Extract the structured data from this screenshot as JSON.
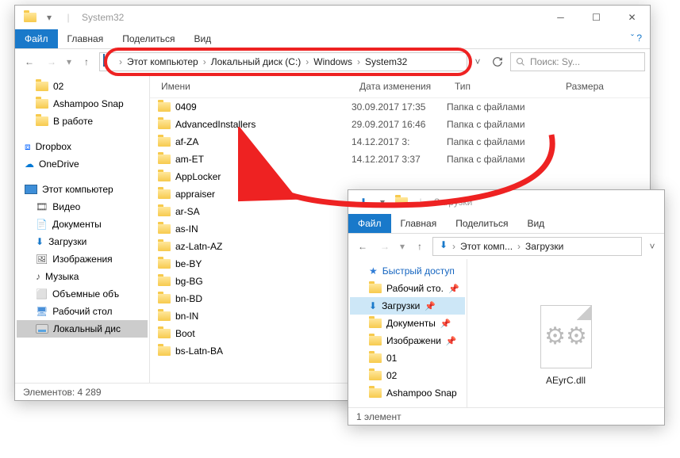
{
  "main": {
    "title": "System32",
    "ribbon": {
      "file": "Файл",
      "home": "Главная",
      "share": "Поделиться",
      "view": "Вид"
    },
    "breadcrumb": [
      "Этот компьютер",
      "Локальный диск (C:)",
      "Windows",
      "System32"
    ],
    "search_placeholder": "Поиск: Sy...",
    "columns": {
      "name": "Имени",
      "date": "Дата изменения",
      "type": "Тип",
      "size": "Размера"
    },
    "tree": [
      {
        "label": "02"
      },
      {
        "label": "Ashampoo Snap"
      },
      {
        "label": "В работе"
      },
      {
        "label": "Dropbox",
        "icon": "dropbox"
      },
      {
        "label": "OneDrive",
        "icon": "onedrive"
      },
      {
        "label": "Этот компьютер",
        "icon": "pc",
        "exp": true
      },
      {
        "label": "Видео",
        "icon": "video"
      },
      {
        "label": "Документы",
        "icon": "doc"
      },
      {
        "label": "Загрузки",
        "icon": "dl"
      },
      {
        "label": "Изображения",
        "icon": "img"
      },
      {
        "label": "Музыка",
        "icon": "music"
      },
      {
        "label": "Объемные объ",
        "icon": "3d"
      },
      {
        "label": "Рабочий стол",
        "icon": "desk"
      },
      {
        "label": "Локальный дис",
        "icon": "disk",
        "sel": true
      }
    ],
    "files": [
      {
        "name": "0409",
        "date": "30.09.2017 17:35",
        "type": "Папка с файлами"
      },
      {
        "name": "AdvancedInstallers",
        "date": "29.09.2017 16:46",
        "type": "Папка с файлами"
      },
      {
        "name": "af-ZA",
        "date": "14.12.2017 3:",
        "type": "Папка с файлами"
      },
      {
        "name": "am-ET",
        "date": "14.12.2017 3:37",
        "type": "Папка с файлами"
      },
      {
        "name": "AppLocker",
        "date": "",
        "type": ""
      },
      {
        "name": "appraiser",
        "date": "",
        "type": ""
      },
      {
        "name": "ar-SA",
        "date": "",
        "type": ""
      },
      {
        "name": "as-IN",
        "date": "",
        "type": ""
      },
      {
        "name": "az-Latn-AZ",
        "date": "",
        "type": ""
      },
      {
        "name": "be-BY",
        "date": "",
        "type": ""
      },
      {
        "name": "bg-BG",
        "date": "",
        "type": ""
      },
      {
        "name": "bn-BD",
        "date": "",
        "type": ""
      },
      {
        "name": "bn-IN",
        "date": "",
        "type": ""
      },
      {
        "name": "Boot",
        "date": "",
        "type": ""
      },
      {
        "name": "bs-Latn-BA",
        "date": "",
        "type": ""
      }
    ],
    "status": "Элементов: 4 289"
  },
  "sec": {
    "title": "Загрузки",
    "ribbon": {
      "file": "Файл",
      "home": "Главная",
      "share": "Поделиться",
      "view": "Вид"
    },
    "breadcrumb": [
      "Этот комп...",
      "Загрузки"
    ],
    "tree": [
      {
        "label": "Быстрый доступ",
        "icon": "star",
        "qa": true
      },
      {
        "label": "Рабочий сто.",
        "pin": true
      },
      {
        "label": "Загрузки",
        "pin": true,
        "sel": true,
        "icon": "dl"
      },
      {
        "label": "Документы",
        "pin": true
      },
      {
        "label": "Изображени",
        "pin": true
      },
      {
        "label": "01"
      },
      {
        "label": "02"
      },
      {
        "label": "Ashampoo Snap"
      }
    ],
    "file": "AEyrC.dll",
    "status": "1 элемент"
  }
}
